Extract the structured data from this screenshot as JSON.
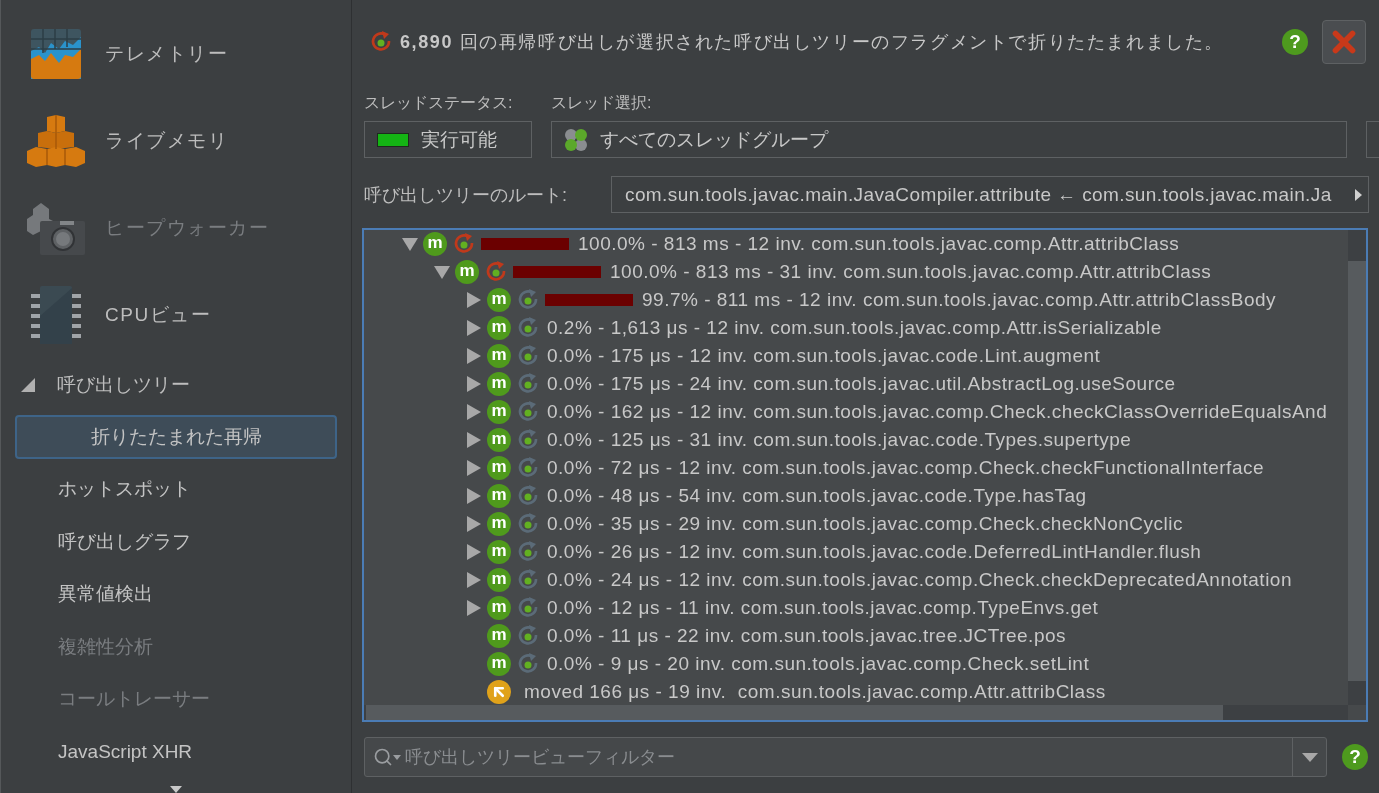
{
  "sidebar": {
    "views": [
      {
        "kind": "telemetry",
        "label": "テレメトリー",
        "disabled": false
      },
      {
        "kind": "memory",
        "label": "ライブメモリ",
        "disabled": false
      },
      {
        "kind": "heap",
        "label": "ヒープウォーカー",
        "disabled": true
      },
      {
        "kind": "cpu",
        "label": "CPUビュー",
        "disabled": false
      }
    ],
    "section": {
      "label": "呼び出しツリー",
      "expanded": true,
      "items": [
        {
          "label": "折りたたまれた再帰",
          "selected": true,
          "disabled": false
        },
        {
          "label": "ホットスポット",
          "selected": false,
          "disabled": false
        },
        {
          "label": "呼び出しグラフ",
          "selected": false,
          "disabled": false
        },
        {
          "label": "異常値検出",
          "selected": false,
          "disabled": false
        },
        {
          "label": "複雑性分析",
          "selected": false,
          "disabled": true
        },
        {
          "label": "コールトレーサー",
          "selected": false,
          "disabled": true
        },
        {
          "label": "JavaScript XHR",
          "selected": false,
          "disabled": false
        }
      ]
    }
  },
  "banner": {
    "message": "**6,890** 回の再帰呼び出しが選択された呼び出しツリーのフラグメントで折りたたまれました。",
    "help": "?"
  },
  "thread_status": {
    "label": "スレッドステータス:",
    "value": "実行可能"
  },
  "thread_selection": {
    "label": "スレッド選択:",
    "value": "すべてのスレッドグループ"
  },
  "call_tree_root": {
    "label": "呼び出しツリーのルート:",
    "value": "com.sun.tools.javac.main.JavaCompiler.attribute ← com.sun.tools.javac.main.Ja"
  },
  "tree": {
    "rows": [
      {
        "kind": "method",
        "badge": "m",
        "expanded": true,
        "color": "#c0391b",
        "level": 1.0,
        "text": "100.0% - 813 ms - 12 inv. com.sun.tools.javac.comp.Attr.attribClass",
        "children": [
          {
            "kind": "method",
            "badge": "m",
            "expanded": true,
            "color": "#c0391b",
            "level": 1.0,
            "text": "100.0% - 813 ms - 31 inv. com.sun.tools.javac.comp.Attr.attribClass",
            "children": [
              {
                "kind": "method",
                "badge": "m",
                "expanded": false,
                "color": "#5b6b78",
                "level": 0.997,
                "text": "99.7% - 811 ms - 12 inv. com.sun.tools.javac.comp.Attr.attribClassBody"
              },
              {
                "kind": "method",
                "badge": "m",
                "expanded": false,
                "color": "#5b6b78",
                "text": "0.2% - 1,613 μs - 12 inv. com.sun.tools.javac.comp.Attr.isSerializable"
              },
              {
                "kind": "method",
                "badge": "m",
                "expanded": false,
                "color": "#5b6b78",
                "text": "0.0% - 175 μs - 12 inv. com.sun.tools.javac.code.Lint.augment"
              },
              {
                "kind": "method",
                "badge": "m",
                "expanded": false,
                "color": "#5b6b78",
                "text": "0.0% - 175 μs - 24 inv. com.sun.tools.javac.util.AbstractLog.useSource"
              },
              {
                "kind": "method",
                "badge": "m",
                "expanded": false,
                "color": "#5b6b78",
                "text": "0.0% - 162 μs - 12 inv. com.sun.tools.javac.comp.Check.checkClassOverrideEqualsAnd"
              },
              {
                "kind": "method",
                "badge": "m",
                "expanded": false,
                "color": "#5b6b78",
                "text": "0.0% - 125 μs - 31 inv. com.sun.tools.javac.code.Types.supertype"
              },
              {
                "kind": "method",
                "badge": "m",
                "expanded": false,
                "color": "#5b6b78",
                "text": "0.0% - 72 μs - 12 inv. com.sun.tools.javac.comp.Check.checkFunctionalInterface"
              },
              {
                "kind": "method",
                "badge": "m",
                "expanded": false,
                "color": "#5b6b78",
                "text": "0.0% - 48 μs - 54 inv. com.sun.tools.javac.code.Type.hasTag"
              },
              {
                "kind": "method",
                "badge": "m",
                "expanded": false,
                "color": "#5b6b78",
                "text": "0.0% - 35 μs - 29 inv. com.sun.tools.javac.comp.Check.checkNonCyclic"
              },
              {
                "kind": "method",
                "badge": "m",
                "expanded": false,
                "color": "#5b6b78",
                "text": "0.0% - 26 μs - 12 inv. com.sun.tools.javac.code.DeferredLintHandler.flush"
              },
              {
                "kind": "method",
                "badge": "m",
                "expanded": false,
                "color": "#5b6b78",
                "text": "0.0% - 24 μs - 12 inv. com.sun.tools.javac.comp.Check.checkDeprecatedAnnotation"
              },
              {
                "kind": "method",
                "badge": "m",
                "expanded": false,
                "color": "#5b6b78",
                "text": "0.0% - 12 μs - 11 inv. com.sun.tools.javac.comp.TypeEnvs.get"
              },
              {
                "kind": "method",
                "badge": "m",
                "color": "#5b6b78",
                "text": "0.0% - 11 μs - 22 inv. com.sun.tools.javac.tree.JCTree.pos"
              },
              {
                "kind": "method",
                "badge": "m",
                "color": "#5b6b78",
                "text": "0.0% - 9 μs - 20 inv. com.sun.tools.javac.comp.Check.setLint"
              },
              {
                "kind": "moved",
                "text": "moved 166 μs - 19 inv.  com.sun.tools.javac.comp.Attr.attribClass"
              }
            ]
          }
        ]
      }
    ]
  },
  "filter": {
    "placeholder": "呼び出しツリービューフィルター",
    "help": "?"
  }
}
